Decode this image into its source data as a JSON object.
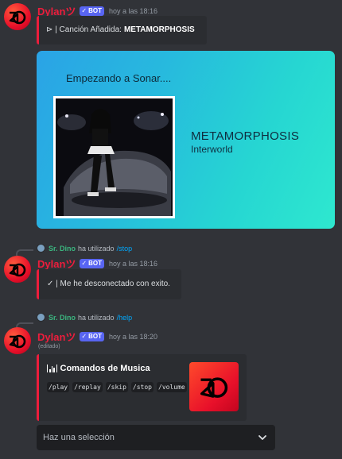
{
  "messages": [
    {
      "username": "Dylan",
      "username_symbol": "ツ",
      "bot_badge": "BOT",
      "timestamp": "hoy a las 18:16",
      "embed": {
        "prefix": "⊳ | Canción Añadida:",
        "song": "METAMORPHOSIS"
      },
      "card": {
        "starting_text": "Empezando a Sonar....",
        "song_title": "METAMORPHOSIS",
        "artist": "Interworld"
      }
    },
    {
      "reply": {
        "user": "Sr. Dino",
        "text": "ha utilizado",
        "command": "/stop"
      },
      "username": "Dylan",
      "username_symbol": "ツ",
      "bot_badge": "BOT",
      "timestamp": "hoy a las 18:16",
      "embed": {
        "text": "✓ | Me he desconectado con exito."
      }
    },
    {
      "reply": {
        "user": "Sr. Dino",
        "text": "ha utilizado",
        "command": "/help"
      },
      "username": "Dylan",
      "username_symbol": "ツ",
      "bot_badge": "BOT",
      "timestamp": "hoy a las 18:20",
      "edited": "(editado)",
      "embed": {
        "title": "Comandos de Musica",
        "commands": [
          "/play",
          "/replay",
          "/skip",
          "/stop",
          "/volume"
        ]
      },
      "select": {
        "placeholder": "Haz una selección"
      }
    }
  ],
  "colors": {
    "background": "#313338",
    "embed_bg": "#2b2d31",
    "accent_red": "#ed1d3c",
    "username": "#ed1d3c",
    "bot_badge": "#5865f2",
    "reply_user": "#3bb57f",
    "command_link": "#00a8fc"
  },
  "icons": [
    "avatar-logo-icon",
    "bot-verified-check-icon",
    "play-triangle-icon",
    "checkmark-icon",
    "equalizer-bars-icon",
    "chevron-down-icon"
  ]
}
